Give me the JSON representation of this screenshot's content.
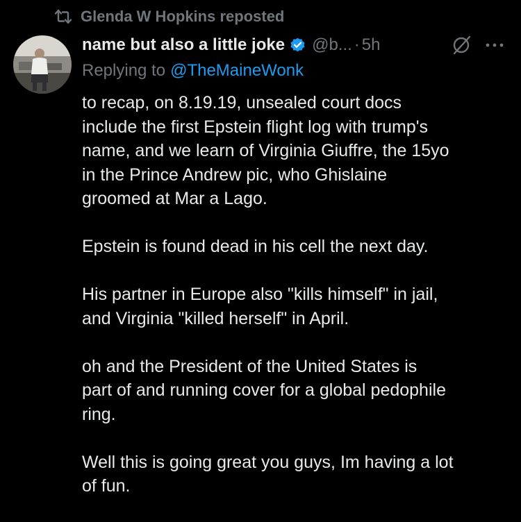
{
  "repost": {
    "text": "Glenda W Hopkins reposted"
  },
  "tweet": {
    "display_name": "name but also a little joke",
    "handle": "@b...",
    "separator": "·",
    "time": "5h",
    "reply_prefix": "Replying to",
    "reply_to": "@TheMaineWonk",
    "paragraphs": [
      "to recap, on 8.19.19, unsealed court docs\ninclude the first Epstein flight log with trump's\nname, and we learn of Virginia Giuffre, the 15yo\nin the Prince Andrew pic, who Ghislaine\ngroomed at Mar a Lago.",
      "Epstein is found dead in his cell the next day.",
      "His partner in Europe also \"kills himself\" in jail,\nand Virginia \"killed herself\" in April.",
      "oh and the President of the United States is\npart of and running cover for a global pedophile\nring.",
      "Well this is going great you guys, Im having a lot\nof fun."
    ]
  },
  "icons": {
    "repost": "repost-icon",
    "verified": "verified-badge-icon",
    "grok": "grok-icon",
    "more": "more-options-icon"
  },
  "colors": {
    "background": "#000000",
    "text_primary": "#e7e9ea",
    "text_secondary": "#71767b",
    "link": "#1d9bf0",
    "verified": "#1d9bf0"
  }
}
